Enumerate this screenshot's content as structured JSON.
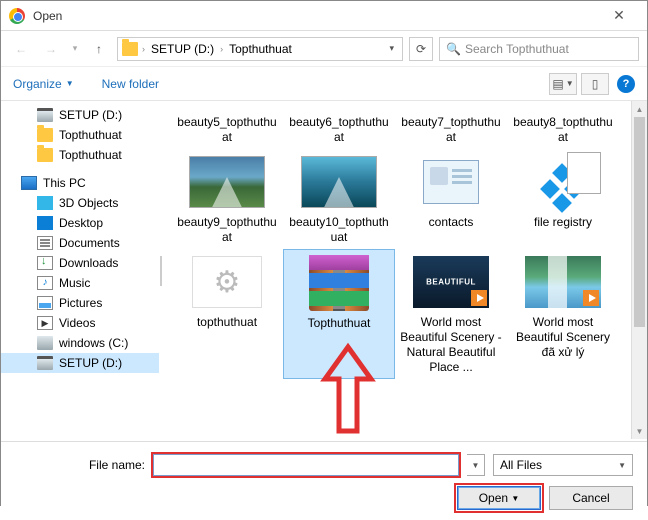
{
  "title": "Open",
  "path": {
    "segments": [
      "SETUP (D:)",
      "Topthuthuat"
    ]
  },
  "search": {
    "placeholder": "Search Topthuthuat"
  },
  "toolbar": {
    "organize": "Organize",
    "newfolder": "New folder"
  },
  "sidebar": {
    "items": [
      {
        "label": "SETUP (D:)",
        "icon": "drive",
        "level": 1
      },
      {
        "label": "Topthuthuat",
        "icon": "folder",
        "level": 1
      },
      {
        "label": "Topthuthuat",
        "icon": "folder",
        "level": 1
      },
      {
        "sep": true
      },
      {
        "label": "This PC",
        "icon": "pc",
        "level": 0
      },
      {
        "label": "3D Objects",
        "icon": "3d",
        "level": 1
      },
      {
        "label": "Desktop",
        "icon": "desk",
        "level": 1
      },
      {
        "label": "Documents",
        "icon": "doc",
        "level": 1
      },
      {
        "label": "Downloads",
        "icon": "down",
        "level": 1
      },
      {
        "label": "Music",
        "icon": "music",
        "level": 1
      },
      {
        "label": "Pictures",
        "icon": "pic",
        "level": 1
      },
      {
        "label": "Videos",
        "icon": "vid",
        "level": 1
      },
      {
        "label": "windows (C:)",
        "icon": "win",
        "level": 1
      },
      {
        "label": "SETUP (D:)",
        "icon": "drive",
        "level": 1,
        "sel": true
      }
    ]
  },
  "files": [
    {
      "name": "beauty5_topthuthuat",
      "type": "label"
    },
    {
      "name": "beauty6_topthuthuat",
      "type": "label"
    },
    {
      "name": "beauty7_topthuthuat",
      "type": "label"
    },
    {
      "name": "beauty8_topthuthuat",
      "type": "label"
    },
    {
      "name": "beauty9_topthuthuat",
      "type": "img"
    },
    {
      "name": "beauty10_topthuthuat",
      "type": "img2"
    },
    {
      "name": "contacts",
      "type": "contact"
    },
    {
      "name": "file registry",
      "type": "reg"
    },
    {
      "name": "topthuthuat",
      "type": "gear"
    },
    {
      "name": "Topthuthuat",
      "type": "rar",
      "sel": true
    },
    {
      "name": "World most Beautiful Scenery - Natural Beautiful Place ...",
      "type": "vid1"
    },
    {
      "name": "World most Beautiful Scenery đã xử lý",
      "type": "vid2"
    }
  ],
  "bottom": {
    "filename_label": "File name:",
    "filename_value": "",
    "filter": "All Files",
    "open": "Open",
    "cancel": "Cancel"
  }
}
